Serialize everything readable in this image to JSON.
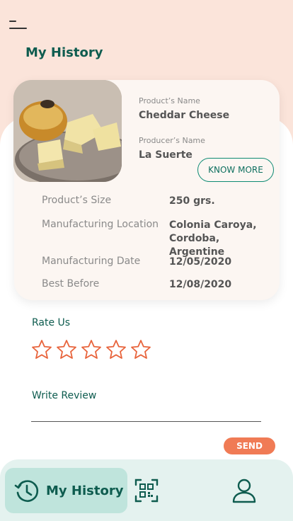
{
  "header": {
    "menu_icon": "hamburger-menu-icon",
    "title": "My History"
  },
  "product": {
    "image_alt": "cheese-photo",
    "name_label": "Product’s Name",
    "name": "Cheddar Cheese",
    "producer_label": "Producer’s Name",
    "producer": "La Suerte",
    "know_more": "KNOW MORE",
    "details": [
      {
        "label": "Product’s Size",
        "value": "250 grs."
      },
      {
        "label": "Manufacturing Location",
        "value": "Colonia Caroya, Cordoba, Argentine"
      },
      {
        "label": "Manufacturing Date",
        "value": "12/05/2020"
      },
      {
        "label": "Best Before",
        "value": "12/08/2020"
      }
    ]
  },
  "rating": {
    "label": "Rate Us",
    "max_stars": 5,
    "selected": 0
  },
  "review": {
    "label": "Write Review",
    "value": "",
    "send": "SEND"
  },
  "nav": {
    "active_label": "My History",
    "items": [
      "history-clock-icon",
      "qr-code-icon",
      "user-profile-icon"
    ]
  },
  "colors": {
    "accent_green": "#0e5c4f",
    "peach_bg": "#fbe4da",
    "send_orange": "#f07b55",
    "star_orange": "#e8643c",
    "nav_bg": "#e4f2ef",
    "nav_active": "#bfe4dc"
  }
}
